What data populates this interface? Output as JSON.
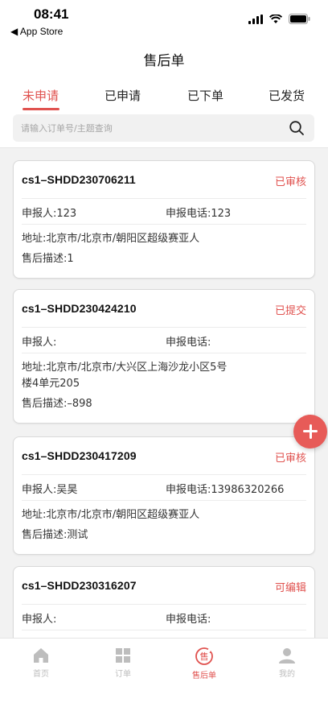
{
  "status_bar": {
    "time": "08:41",
    "back_label": "◀ App Store"
  },
  "header": {
    "title": "售后单"
  },
  "tabs": [
    {
      "label": "未申请",
      "active": true
    },
    {
      "label": "已申请",
      "active": false
    },
    {
      "label": "已下单",
      "active": false
    },
    {
      "label": "已发货",
      "active": false
    }
  ],
  "search": {
    "placeholder": "请输入订单号/主题查询",
    "icon": "search-icon"
  },
  "orders": [
    {
      "order_no": "cs1–SHDD230706211",
      "status": "已审核",
      "reporter": "申报人:123",
      "phone": "申报电话:123",
      "address_line1": "地址:北京市/北京市/朝阳区超级赛亚人",
      "address_line2": "",
      "description": "售后描述:1"
    },
    {
      "order_no": "cs1–SHDD230424210",
      "status": "已提交",
      "reporter": "申报人:",
      "phone": "申报电话:",
      "address_line1": "地址:北京市/北京市/大兴区上海沙龙小区5号",
      "address_line2": "楼4单元205",
      "description": "售后描述:–898"
    },
    {
      "order_no": "cs1–SHDD230417209",
      "status": "已审核",
      "reporter": "申报人:吴昊",
      "phone": "申报电话:13986320266",
      "address_line1": "地址:北京市/北京市/朝阳区超级赛亚人",
      "address_line2": "",
      "description": "售后描述:测试"
    },
    {
      "order_no": "cs1–SHDD230316207",
      "status": "可编辑",
      "reporter": "申报人:",
      "phone": "申报电话:",
      "address_line1": "",
      "address_line2": "",
      "description": ""
    }
  ],
  "fab": {
    "icon": "plus-icon"
  },
  "tabbar": [
    {
      "label": "首页",
      "icon": "home-icon",
      "active": false
    },
    {
      "label": "订单",
      "icon": "grid-icon",
      "active": false
    },
    {
      "label": "售后单",
      "icon": "after-sale-icon",
      "active": true
    },
    {
      "label": "我的",
      "icon": "user-icon",
      "active": false
    }
  ],
  "colors": {
    "accent": "#e0524f",
    "fab": "#e75b58",
    "inactive": "#bdbdbd"
  }
}
